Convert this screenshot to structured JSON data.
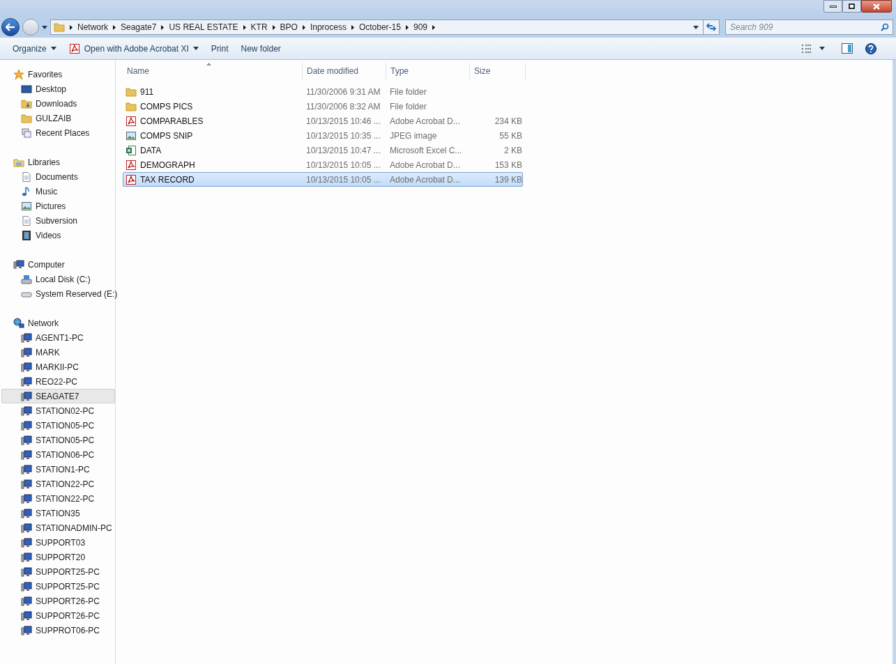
{
  "breadcrumb": [
    "Network",
    "Seagate7",
    "US REAL ESTATE",
    "KTR",
    "BPO",
    "Inprocess",
    "October-15",
    "909"
  ],
  "search": {
    "placeholder": "Search 909"
  },
  "toolbar": [
    {
      "label": "Organize",
      "kind": "menu"
    },
    {
      "label": "Open with Adobe Acrobat XI",
      "kind": "pdf-menu"
    },
    {
      "label": "Print",
      "kind": "plain"
    },
    {
      "label": "New folder",
      "kind": "plain"
    }
  ],
  "sidebar": [
    {
      "label": "Favorites",
      "kind": "star",
      "items": [
        {
          "label": "Desktop",
          "kind": "desktop",
          "selected": false
        },
        {
          "label": "Downloads",
          "kind": "downloads",
          "selected": false
        },
        {
          "label": "GULZAIB",
          "kind": "folder",
          "selected": false
        },
        {
          "label": "Recent Places",
          "kind": "recent",
          "selected": false
        }
      ]
    },
    {
      "label": "Libraries",
      "kind": "libraries",
      "items": [
        {
          "label": "Documents",
          "kind": "document",
          "selected": false
        },
        {
          "label": "Music",
          "kind": "music",
          "selected": false
        },
        {
          "label": "Pictures",
          "kind": "picture",
          "selected": false
        },
        {
          "label": "Subversion",
          "kind": "document",
          "selected": false
        },
        {
          "label": "Videos",
          "kind": "video",
          "selected": false
        }
      ]
    },
    {
      "label": "Computer",
      "kind": "computer",
      "items": [
        {
          "label": "Local Disk (C:)",
          "kind": "disk",
          "selected": false
        },
        {
          "label": "System Reserved (E:)",
          "kind": "drive",
          "selected": false
        }
      ]
    },
    {
      "label": "Network",
      "kind": "network",
      "items": [
        {
          "label": "AGENT1-PC",
          "kind": "pc",
          "selected": false
        },
        {
          "label": "MARK",
          "kind": "pc",
          "selected": false
        },
        {
          "label": "MARKII-PC",
          "kind": "pc",
          "selected": false
        },
        {
          "label": "REO22-PC",
          "kind": "pc",
          "selected": false
        },
        {
          "label": "SEAGATE7",
          "kind": "pc",
          "selected": true
        },
        {
          "label": "STATION02-PC",
          "kind": "pc",
          "selected": false
        },
        {
          "label": "STATION05-PC",
          "kind": "pc",
          "selected": false
        },
        {
          "label": "STATION05-PC",
          "kind": "pc",
          "selected": false
        },
        {
          "label": "STATION06-PC",
          "kind": "pc",
          "selected": false
        },
        {
          "label": "STATION1-PC",
          "kind": "pc",
          "selected": false
        },
        {
          "label": "STATION22-PC",
          "kind": "pc",
          "selected": false
        },
        {
          "label": "STATION22-PC",
          "kind": "pc",
          "selected": false
        },
        {
          "label": "STATION35",
          "kind": "pc",
          "selected": false
        },
        {
          "label": "STATIONADMIN-PC",
          "kind": "pc",
          "selected": false
        },
        {
          "label": "SUPPORT03",
          "kind": "pc",
          "selected": false
        },
        {
          "label": "SUPPORT20",
          "kind": "pc",
          "selected": false
        },
        {
          "label": "SUPPORT25-PC",
          "kind": "pc",
          "selected": false
        },
        {
          "label": "SUPPORT25-PC",
          "kind": "pc",
          "selected": false
        },
        {
          "label": "SUPPORT26-PC",
          "kind": "pc",
          "selected": false
        },
        {
          "label": "SUPPORT26-PC",
          "kind": "pc",
          "selected": false
        },
        {
          "label": "SUPPROT06-PC",
          "kind": "pc",
          "selected": false
        }
      ]
    }
  ],
  "table": {
    "columns": [
      "Name",
      "Date modified",
      "Type",
      "Size"
    ],
    "rows": [
      {
        "name": "911",
        "kind": "folder",
        "date": "11/30/2006 9:31 AM",
        "type": "File folder",
        "size": "",
        "selected": false
      },
      {
        "name": "COMPS PICS",
        "kind": "folder",
        "date": "11/30/2006 8:32 AM",
        "type": "File folder",
        "size": "",
        "selected": false
      },
      {
        "name": "COMPARABLES",
        "kind": "pdf",
        "date": "10/13/2015 10:46 ...",
        "type": "Adobe Acrobat D...",
        "size": "234 KB",
        "selected": false
      },
      {
        "name": "COMPS SNIP",
        "kind": "jpeg",
        "date": "10/13/2015 10:35 ...",
        "type": "JPEG image",
        "size": "55 KB",
        "selected": false
      },
      {
        "name": "DATA",
        "kind": "excel",
        "date": "10/13/2015 10:47 ...",
        "type": "Microsoft Excel C...",
        "size": "2 KB",
        "selected": false
      },
      {
        "name": "DEMOGRAPH",
        "kind": "pdf",
        "date": "10/13/2015 10:05 ...",
        "type": "Adobe Acrobat D...",
        "size": "153 KB",
        "selected": false
      },
      {
        "name": "TAX RECORD",
        "kind": "pdf",
        "date": "10/13/2015 10:05 ...",
        "type": "Adobe Acrobat D...",
        "size": "139 KB",
        "selected": true
      }
    ]
  }
}
